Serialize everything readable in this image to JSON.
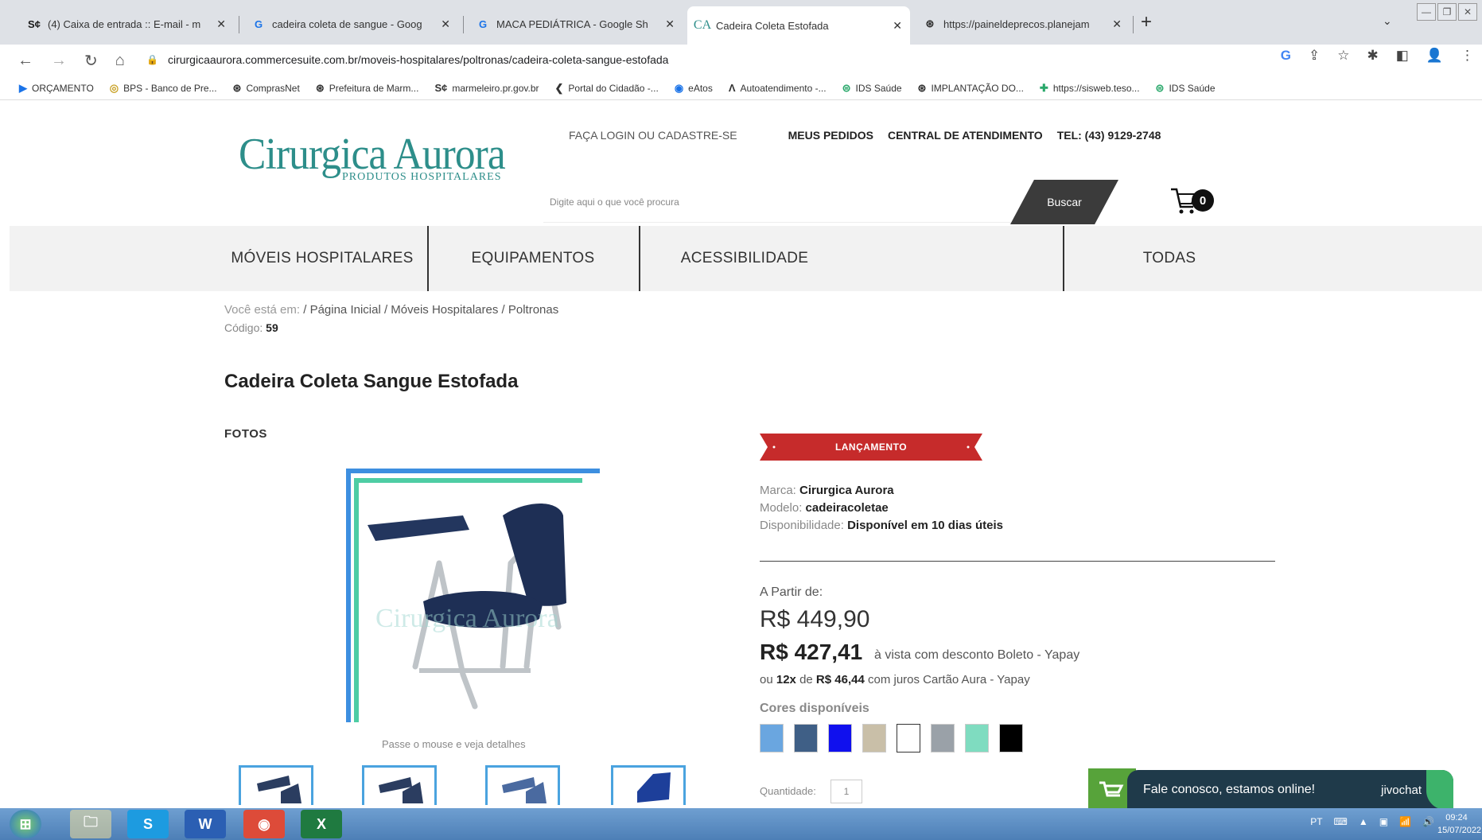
{
  "browser": {
    "tabs": [
      {
        "favicon": "S¢",
        "title": "(4) Caixa de entrada :: E-mail - m"
      },
      {
        "favicon": "G",
        "title": "cadeira coleta de sangue - Goog"
      },
      {
        "favicon": "G",
        "title": "MACA PEDIÁTRICA - Google Sh"
      },
      {
        "favicon": "CA",
        "title": "Cadeira Coleta Estofada"
      },
      {
        "favicon": "⊛",
        "title": "https://paineldeprecos.planejam"
      }
    ],
    "url": "cirurgicaaurora.commercesuite.com.br/moveis-hospitalares/poltronas/cadeira-coleta-sangue-estofada",
    "bookmarks": [
      {
        "icon": "▶",
        "label": "ORÇAMENTO"
      },
      {
        "icon": "◎",
        "label": "BPS - Banco de Pre..."
      },
      {
        "icon": "⊛",
        "label": "ComprasNet"
      },
      {
        "icon": "⊛",
        "label": "Prefeitura de Marm..."
      },
      {
        "icon": "S¢",
        "label": "marmeleiro.pr.gov.br"
      },
      {
        "icon": "❮",
        "label": "Portal do Cidadão -..."
      },
      {
        "icon": "◉",
        "label": "eAtos"
      },
      {
        "icon": "Λ",
        "label": "Autoatendimento -..."
      },
      {
        "icon": "⊜",
        "label": "IDS Saúde"
      },
      {
        "icon": "⊛",
        "label": "IMPLANTAÇÃO DO..."
      },
      {
        "icon": "✚",
        "label": "https://sisweb.teso..."
      },
      {
        "icon": "⊜",
        "label": "IDS Saúde"
      }
    ]
  },
  "header": {
    "logo": "Cirurgica Aurora",
    "logo_sub": "PRODUTOS HOSPITALARES",
    "login": "FAÇA LOGIN OU CADASTRE-SE",
    "orders": "MEUS PEDIDOS",
    "support": "CENTRAL DE ATENDIMENTO",
    "phone": "TEL: (43) 9129-2748",
    "search_placeholder": "Digite aqui o que você procura",
    "search_button": "Buscar",
    "cart_count": "0"
  },
  "menu": [
    "MÓVEIS HOSPITALARES",
    "EQUIPAMENTOS",
    "ACESSIBILIDADE",
    "TODAS"
  ],
  "breadcrumb": {
    "prefix": "Você está em:",
    "path": "/ Página Inicial / Móveis Hospitalares / Poltronas"
  },
  "code": {
    "label": "Código:",
    "value": "59"
  },
  "product": {
    "title": "Cadeira Coleta Sangue Estofada",
    "photos_label": "FOTOS",
    "image_watermark": "Cirurgica Aurora",
    "hover_hint": "Passe o mouse e veja detalhes",
    "badge": "LANÇAMENTO",
    "brand_label": "Marca:",
    "brand": "Cirurgica Aurora",
    "model_label": "Modelo:",
    "model": "cadeiracoletae",
    "availability_label": "Disponibilidade:",
    "availability": "Disponível em 10 dias úteis",
    "from_label": "A Partir de:",
    "old_price": "R$ 449,90",
    "price": "R$ 427,41",
    "price_desc": "à vista com desconto Boleto - Yapay",
    "install_prefix": "ou",
    "install_count": "12x",
    "install_mid": "de",
    "install_value": "R$ 46,44",
    "install_suffix": "com juros Cartão Aura - Yapay",
    "colors_label": "Cores disponíveis",
    "colors": [
      "#6aa6e0",
      "#3f5f86",
      "#1010ee",
      "#c9bfa8",
      "#ffffff",
      "#9aa1a8",
      "#7fdcc0",
      "#000000"
    ],
    "qty_label": "Quantidade:",
    "qty_value": "1"
  },
  "chat": {
    "text": "Fale conosco, estamos online!",
    "brand": "jivochat"
  },
  "taskbar": {
    "lang": "PT",
    "time": "09:24",
    "date": "15/07/2022"
  }
}
